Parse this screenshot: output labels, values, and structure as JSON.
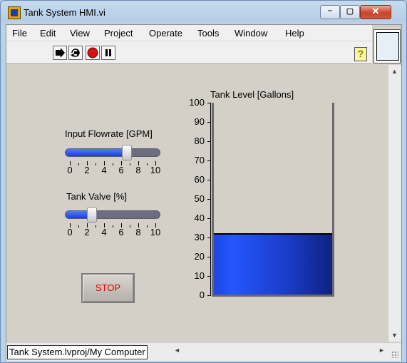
{
  "window": {
    "title": "Tank System HMI.vi",
    "min_glyph": "–",
    "max_glyph": "▢",
    "close_glyph": "✕"
  },
  "menu": [
    "File",
    "Edit",
    "View",
    "Project",
    "Operate",
    "Tools",
    "Window",
    "Help"
  ],
  "toolbar": {
    "buttons": [
      "run-arrow-icon",
      "run-continuous-icon",
      "abort-icon",
      "pause-icon"
    ],
    "help_label": "?"
  },
  "controls": {
    "flowrate": {
      "label": "Input Flowrate [GPM]",
      "value": 6.7,
      "min": 0,
      "max": 10,
      "ticks": [
        "0",
        "2",
        "4",
        "6",
        "8",
        "10"
      ]
    },
    "valve": {
      "label": "Tank Valve [%]",
      "value": 2.6,
      "min": 0,
      "max": 10,
      "ticks": [
        "0",
        "2",
        "4",
        "6",
        "8",
        "10"
      ]
    },
    "stop_label": "STOP"
  },
  "tank": {
    "label": "Tank Level [Gallons]",
    "value": 32,
    "min": 0,
    "max": 100,
    "scale": [
      "100",
      "90",
      "80",
      "70",
      "60",
      "50",
      "40",
      "30",
      "20",
      "10",
      "0"
    ]
  },
  "status": {
    "path": "Tank System.lvproj/My Computer"
  },
  "colors": {
    "fill": "#1e3fd6",
    "stop_text": "#e00000"
  }
}
